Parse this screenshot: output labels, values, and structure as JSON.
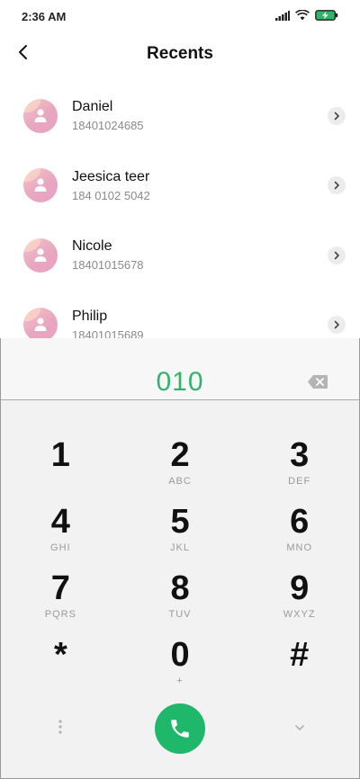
{
  "status_bar": {
    "time": "2:36 AM",
    "icons": [
      "signal-icon",
      "wifi-icon",
      "battery-charging-icon"
    ],
    "battery_color": "#2fb56a"
  },
  "header": {
    "title": "Recents",
    "back_icon": "chevron-left-icon"
  },
  "recents": [
    {
      "name": "Daniel",
      "number": "18401024685"
    },
    {
      "name": "Jeesica teer",
      "number": "184 0102 5042"
    },
    {
      "name": "Nicole",
      "number": "18401015678"
    },
    {
      "name": "Philip",
      "number": "18401015689"
    }
  ],
  "dialer": {
    "dialed_number": "010",
    "accent_color": "#2fb56a",
    "keys": [
      [
        {
          "digit": "1",
          "letters": ""
        },
        {
          "digit": "2",
          "letters": "ABC"
        },
        {
          "digit": "3",
          "letters": "DEF"
        }
      ],
      [
        {
          "digit": "4",
          "letters": "GHI"
        },
        {
          "digit": "5",
          "letters": "JKL"
        },
        {
          "digit": "6",
          "letters": "MNO"
        }
      ],
      [
        {
          "digit": "7",
          "letters": "PQRS"
        },
        {
          "digit": "8",
          "letters": "TUV"
        },
        {
          "digit": "9",
          "letters": "WXYZ"
        }
      ],
      [
        {
          "digit": "*",
          "letters": ""
        },
        {
          "digit": "0",
          "letters": "+"
        },
        {
          "digit": "#",
          "letters": ""
        }
      ]
    ],
    "bottom_icons": [
      "more-options-icon",
      "phone-icon",
      "collapse-keypad-icon"
    ],
    "call_button_color": "#1fb86a"
  }
}
